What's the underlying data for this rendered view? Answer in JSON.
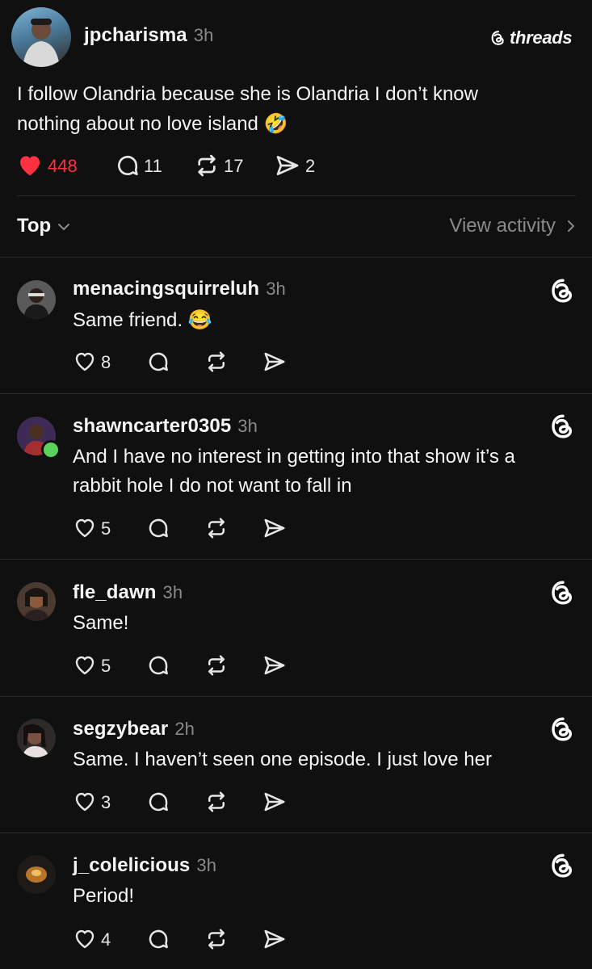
{
  "post": {
    "username": "jpcharisma",
    "time": "3h",
    "brand": "threads",
    "text_line1": "I follow Olandria because she is Olandria I don’t know",
    "text_line2": "nothing about no love island",
    "emoji": "🤣",
    "likes": "448",
    "replies": "11",
    "reposts": "17",
    "shares": "2",
    "liked_color": "#ff3040"
  },
  "filter": {
    "label": "Top",
    "view_activity": "View activity"
  },
  "comments": [
    {
      "username": "menacingsquirreluh",
      "time": "3h",
      "lines": [
        "Same friend."
      ],
      "emoji": "😂",
      "likes": "8"
    },
    {
      "username": "shawncarter0305",
      "time": "3h",
      "lines": [
        "And I have no interest in getting into that show it’s a",
        "rabbit hole I do not want to fall in"
      ],
      "likes": "5"
    },
    {
      "username": "fle_dawn",
      "time": "3h",
      "lines": [
        "Same!"
      ],
      "likes": "5"
    },
    {
      "username": "segzybear",
      "time": "2h",
      "lines": [
        "Same. I haven’t seen one episode. I just love her"
      ],
      "likes": "3"
    },
    {
      "username": "j_colelicious",
      "time": "3h",
      "lines": [
        "Period!"
      ],
      "likes": "4"
    }
  ],
  "colors": {
    "background": "#101010",
    "divider": "#2b2b2b",
    "online": "#5bd25b"
  }
}
